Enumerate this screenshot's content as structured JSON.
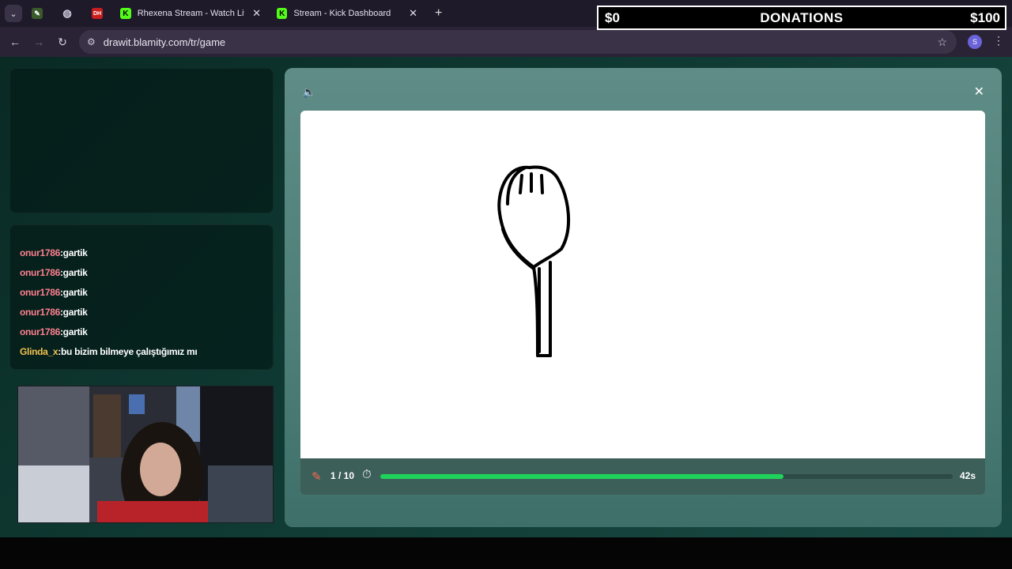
{
  "browser": {
    "tab_menu_icon": "chevron-down-icon",
    "pinned_tabs": [
      {
        "icon": "drawit-icon",
        "label": ""
      },
      {
        "icon": "globe-icon",
        "label": ""
      },
      {
        "icon": "dh-icon",
        "label": "DH"
      }
    ],
    "tabs": [
      {
        "title": "Rhexena Stream - Watch Live o",
        "favicon": "K",
        "close": "✕"
      },
      {
        "title": "Stream - Kick Dashboard",
        "favicon": "K",
        "close": "✕"
      }
    ],
    "new_tab": "+",
    "url": "drawit.blamity.com/tr/game",
    "profile_initial": "S"
  },
  "donations": {
    "current": "$0",
    "title": "DONATIONS",
    "goal": "$100"
  },
  "chat": {
    "messages": [
      {
        "user": "onur1786",
        "text": "gartik",
        "color": "#ff7f8f"
      },
      {
        "user": "onur1786",
        "text": "gartik",
        "color": "#ff7f8f"
      },
      {
        "user": "onur1786",
        "text": "gartik",
        "color": "#ff7f8f"
      },
      {
        "user": "onur1786",
        "text": "gartik",
        "color": "#ff7f8f"
      },
      {
        "user": "onur1786",
        "text": "gartik",
        "color": "#ff7f8f"
      },
      {
        "user": "Glinda_x",
        "text": "bu bizim bilmeye çalıştığımız mı",
        "color": "#f2c14e"
      }
    ]
  },
  "game": {
    "round": "1 / 10",
    "time_left": "42s",
    "progress": 0.705,
    "progress_color": "#1fd35a",
    "drawing": "spoon"
  }
}
